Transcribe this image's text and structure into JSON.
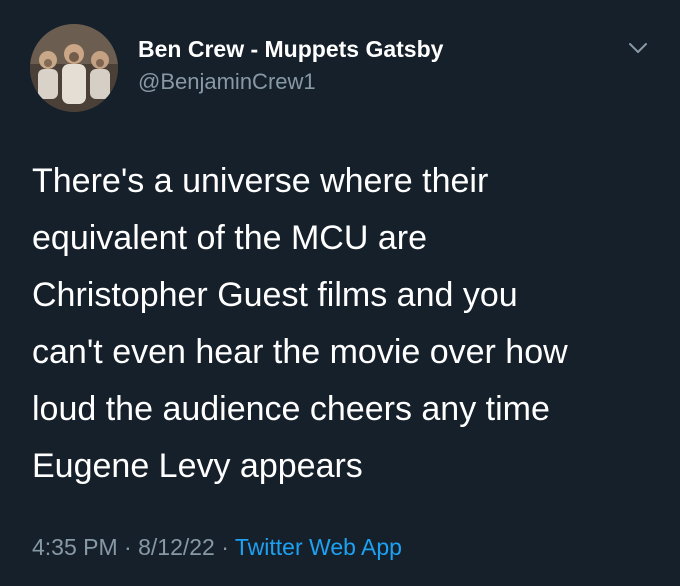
{
  "author": {
    "display_name": "Ben Crew - Muppets Gatsby",
    "handle": "@BenjaminCrew1",
    "avatar_icon": "profile-photo"
  },
  "tweet": {
    "text": "There's a universe where their\nequivalent of the MCU are\nChristopher Guest films and you\ncan't even hear the movie over how\nloud the audience cheers any time\nEugene Levy appears",
    "time": "4:35 PM",
    "date": "8/12/22",
    "separator": "·",
    "source": "Twitter Web App"
  },
  "menu": {
    "icon": "chevron-down-icon"
  },
  "colors": {
    "background": "#15202b",
    "primary_text": "#ffffff",
    "secondary_text": "#8899a6",
    "link": "#1da1f2"
  }
}
